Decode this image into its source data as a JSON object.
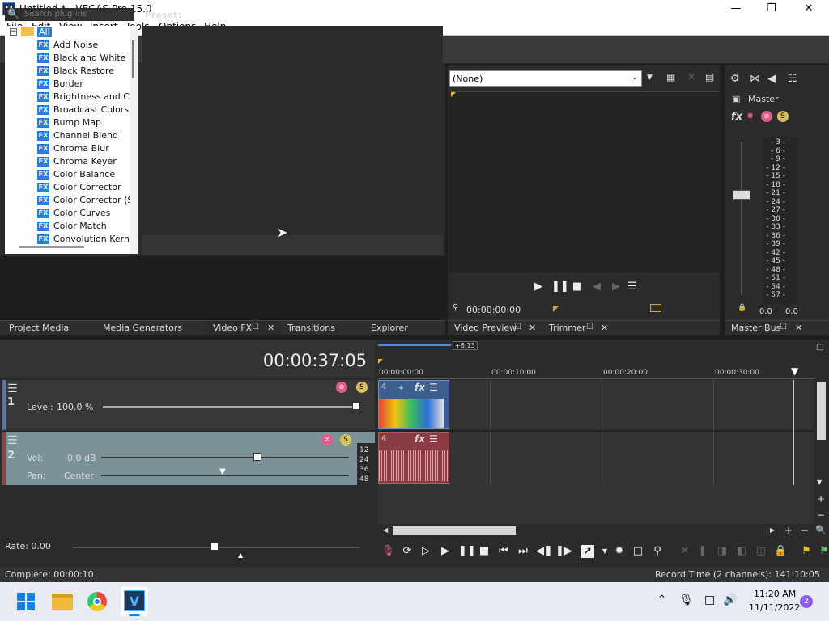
{
  "window": {
    "title": "Untitled * - VEGAS Pro 15.0",
    "app_icon": "V"
  },
  "menu": [
    "File",
    "Edit",
    "View",
    "Insert",
    "Tools",
    "Options",
    "Help"
  ],
  "fx_panel": {
    "search_placeholder": "Search plug-ins",
    "preset_label": "Preset:",
    "root": "All",
    "items": [
      "Add Noise",
      "Black and White",
      "Black Restore",
      "Border",
      "Brightness and Co",
      "Broadcast Colors",
      "Bump Map",
      "Channel Blend",
      "Chroma Blur",
      "Chroma Keyer",
      "Color Balance",
      "Color Corrector",
      "Color Corrector (S",
      "Color Curves",
      "Color Match",
      "Convolution Kerne"
    ],
    "badge": "FX"
  },
  "tabs_left": [
    "Project Media",
    "Media Generators",
    "Video FX",
    "Transitions",
    "Explorer"
  ],
  "preview": {
    "select_value": "(None)",
    "time": "00:00:00:00",
    "tabs": [
      "Video Preview",
      "Trimmer"
    ]
  },
  "master": {
    "label": "Master",
    "scale": [
      "3",
      "6",
      "9",
      "12",
      "15",
      "18",
      "21",
      "24",
      "27",
      "30",
      "33",
      "36",
      "39",
      "42",
      "45",
      "48",
      "51",
      "54",
      "57"
    ],
    "readout_left": "0.0",
    "readout_right": "0.0",
    "tab": "Master Bus"
  },
  "timeline": {
    "timecode": "00:00:37:05",
    "loop_marker": "+6:13",
    "ruler": [
      "00:00:00:00",
      "00:00:10:00",
      "00:00:20:00",
      "00:00:30:00"
    ],
    "video_track": {
      "number": "1",
      "level_label": "Level:",
      "level_value": "100.0 %",
      "clip_number": "4"
    },
    "audio_track": {
      "number": "2",
      "vol_label": "Vol:",
      "vol_value": "0.0 dB",
      "pan_label": "Pan:",
      "pan_value": "Center",
      "clip_number": "4",
      "db_scale": [
        "12",
        "24",
        "36",
        "48"
      ]
    },
    "rate_label": "Rate: 0.00"
  },
  "status": {
    "left": "Complete: 00:00:10",
    "right": "Record Time (2 channels): 141:10:05"
  },
  "taskbar": {
    "time": "11:20 AM",
    "date": "11/11/2022",
    "notifications": "2"
  }
}
